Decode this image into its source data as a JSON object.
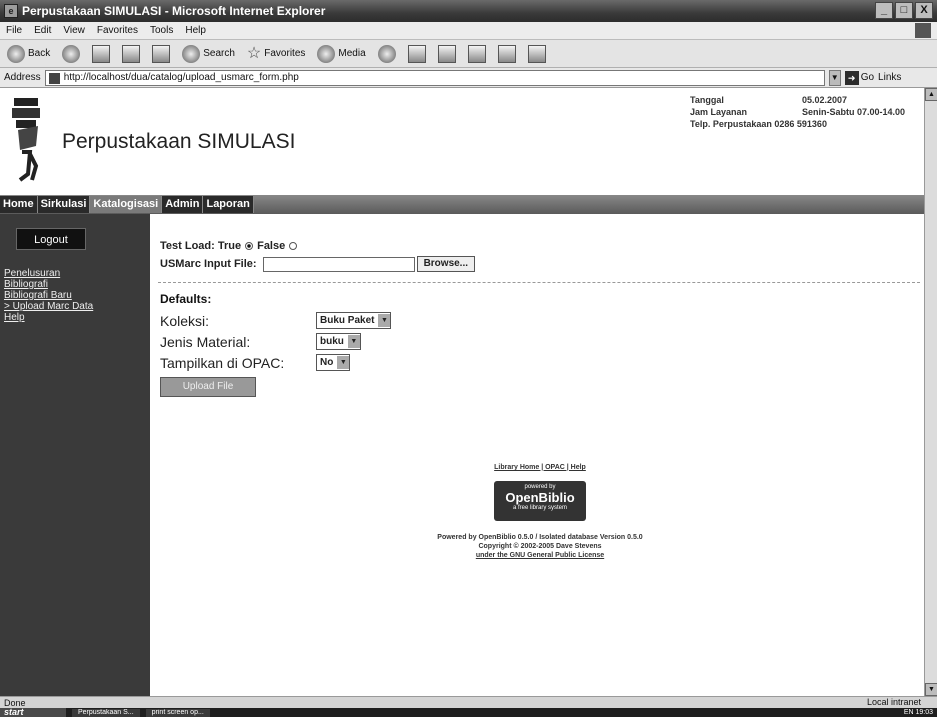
{
  "window": {
    "title": "Perpustakaan SIMULASI - Microsoft Internet Explorer",
    "buttons": [
      "_",
      "□",
      "X"
    ]
  },
  "menubar": [
    "File",
    "Edit",
    "View",
    "Favorites",
    "Tools",
    "Help"
  ],
  "toolbar": {
    "back": "Back",
    "search": "Search",
    "favorites": "Favorites",
    "media": "Media"
  },
  "address": {
    "label": "Address",
    "url": "http://localhost/dua/catalog/upload_usmarc_form.php",
    "go": "Go",
    "links": "Links"
  },
  "header": {
    "site_title": "Perpustakaan SIMULASI",
    "info": [
      {
        "k": "Tanggal",
        "v": "05.02.2007"
      },
      {
        "k": "Jam Layanan",
        "v": "Senin-Sabtu 07.00-14.00"
      },
      {
        "k": "Telp. Perpustakaan",
        "v": "0286 591360"
      }
    ]
  },
  "nav": [
    "Home",
    "Sirkulasi",
    "Katalogisasi",
    "Admin",
    "Laporan"
  ],
  "sidebar": {
    "logout": "Logout",
    "links": [
      "Penelusuran",
      "Bibliografi",
      "Bibliografi Baru",
      "> Upload Marc Data",
      "Help"
    ]
  },
  "form": {
    "test_load_label": "Test Load:",
    "true_label": "True",
    "false_label": "False",
    "usmarc_label": "USMarc Input File:",
    "browse": "Browse..."
  },
  "defaults": {
    "title": "Defaults:",
    "koleksi_label": "Koleksi:",
    "koleksi_value": "Buku Paket",
    "jenis_label": "Jenis Material:",
    "jenis_value": "buku",
    "opac_label": "Tampilkan di OPAC:",
    "opac_value": "No",
    "upload_button": "Upload File"
  },
  "footer": {
    "links": "Library Home | OPAC | Help",
    "badge_powered": "powered by",
    "badge_brand": "OpenBiblio",
    "badge_tag": "a free library system",
    "credit1": "Powered by OpenBiblio 0.5.0 / Isolated database Version 0.5.0",
    "credit2": "Copyright © 2002-2005 Dave Stevens",
    "credit3": "under the GNU General Public License"
  },
  "statusbar": {
    "left": "Done",
    "zone": "Local intranet"
  },
  "taskbar": {
    "start": "start",
    "tasks": [
      "Perpustakaan S...",
      "print screen op..."
    ],
    "tray": "EN  19:03"
  }
}
